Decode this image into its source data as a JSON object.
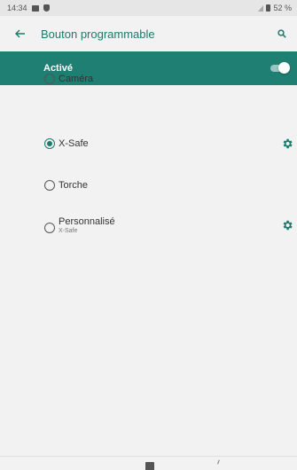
{
  "status_bar": {
    "time": "14:34",
    "battery": "52 %"
  },
  "app_bar": {
    "title": "Bouton programmable",
    "back_icon": "arrow-left-icon",
    "search_icon": "search-icon"
  },
  "master_switch": {
    "label": "Activé",
    "enabled": true
  },
  "options": [
    {
      "label": "Caméra",
      "subtitle": "",
      "selected": false,
      "has_settings": false
    },
    {
      "label": "X-Safe",
      "subtitle": "",
      "selected": true,
      "has_settings": true
    },
    {
      "label": "Torche",
      "subtitle": "",
      "selected": false,
      "has_settings": false
    },
    {
      "label": "Personnalisé",
      "subtitle": "X-Safe",
      "selected": false,
      "has_settings": true
    }
  ],
  "colors": {
    "accent": "#1e7a6c",
    "bar": "#1f7f73"
  }
}
